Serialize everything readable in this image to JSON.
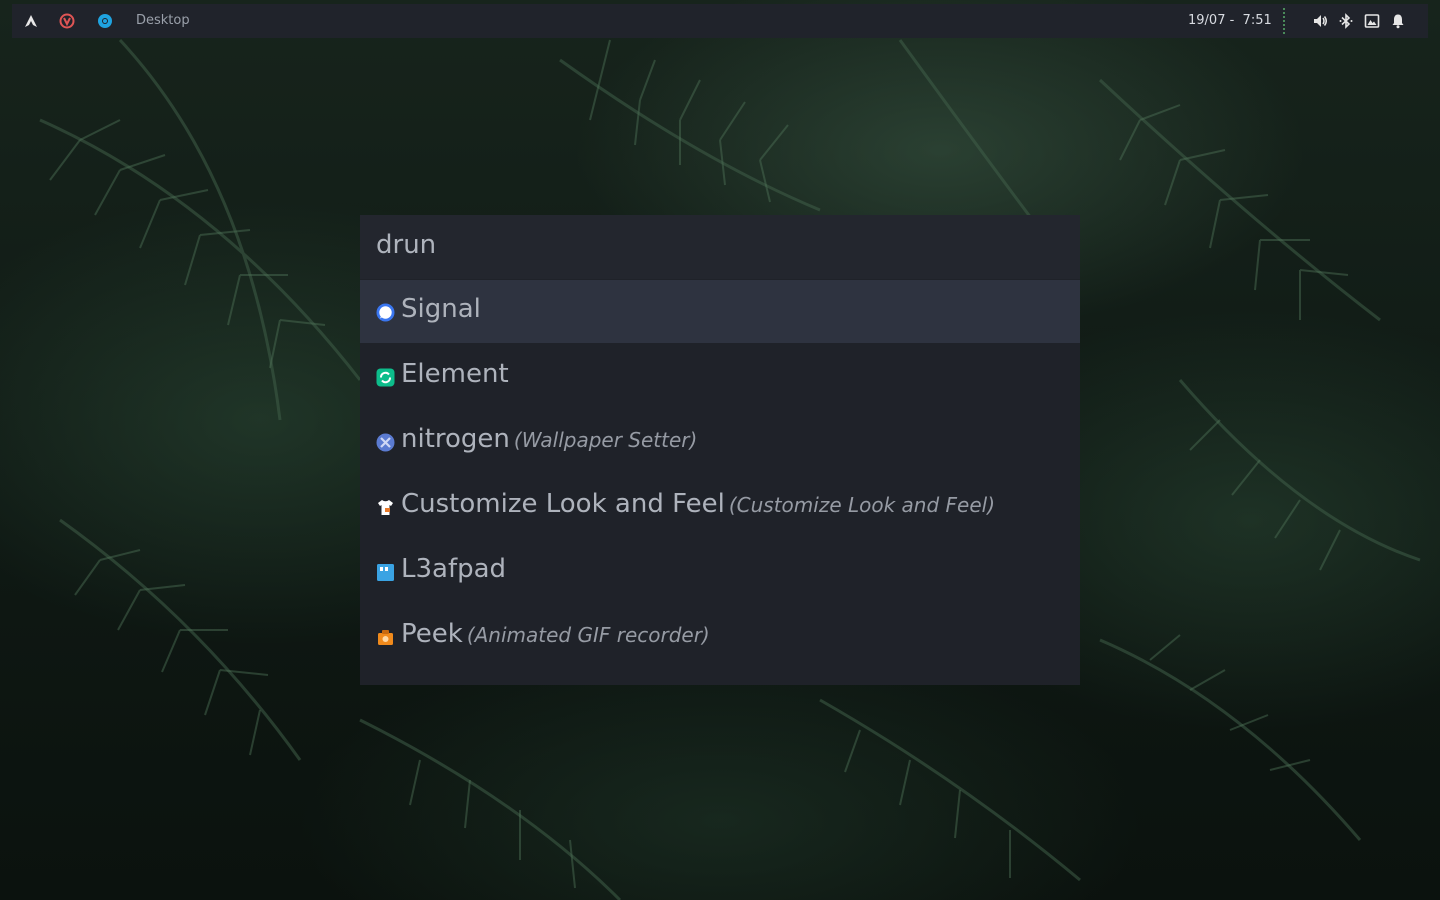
{
  "topbar": {
    "workspace_title": "Desktop",
    "clock": "19/07 -  7:51",
    "launcher_icons": [
      "arch-logo-icon",
      "vivaldi-icon",
      "chrome-icon"
    ],
    "tray_icons": [
      "volume-icon",
      "bluetooth-icon",
      "display-icon",
      "notification-bell-icon"
    ]
  },
  "launcher": {
    "mode": "drun",
    "entries": [
      {
        "name": "Signal",
        "subtitle": "",
        "icon": "signal-icon",
        "color": "#3a76f0",
        "selected": true
      },
      {
        "name": "Element",
        "subtitle": "",
        "icon": "element-icon",
        "color": "#0dbd8b",
        "selected": false
      },
      {
        "name": "nitrogen",
        "subtitle": "(Wallpaper Setter)",
        "icon": "nitrogen-icon",
        "color": "#5b7bd1",
        "selected": false
      },
      {
        "name": "Customize Look and Feel",
        "subtitle": "(Customize Look and Feel)",
        "icon": "shirt-icon",
        "color": "#ffffff",
        "selected": false
      },
      {
        "name": "L3afpad",
        "subtitle": "",
        "icon": "l3afpad-icon",
        "color": "#3aa3e3",
        "selected": false
      },
      {
        "name": "Peek",
        "subtitle": "(Animated GIF recorder)",
        "icon": "peek-icon",
        "color": "#f08a1c",
        "selected": false
      }
    ]
  },
  "colors": {
    "bar_bg": "#20232b",
    "launcher_bg": "#1f2229",
    "selected_bg": "#2e3340",
    "text": "#aeb3bc"
  }
}
